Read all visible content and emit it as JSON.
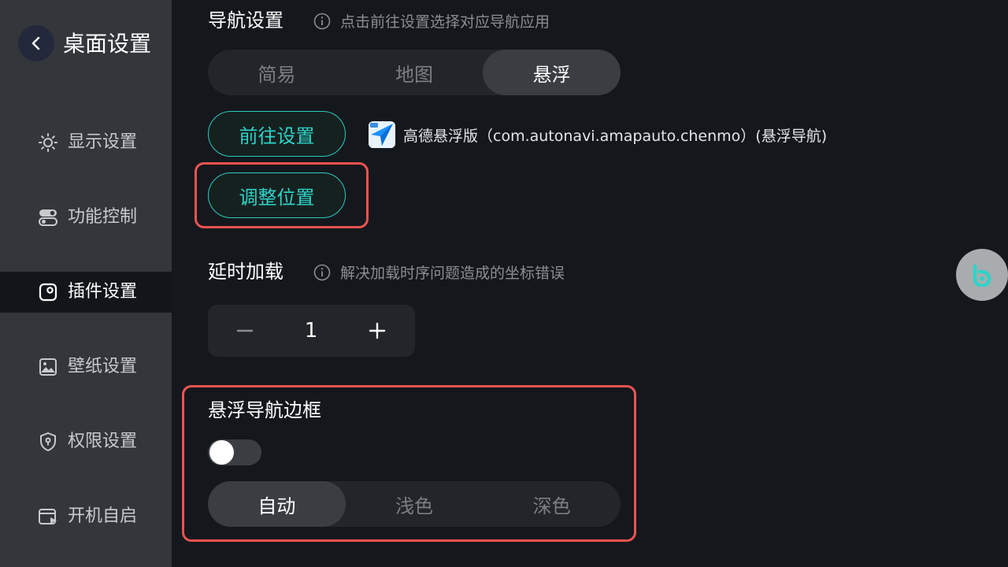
{
  "sidebar": {
    "title": "桌面设置",
    "items": [
      {
        "label": "显示设置",
        "icon": "sun-icon",
        "active": false
      },
      {
        "label": "功能控制",
        "icon": "toggle-icon",
        "active": false
      },
      {
        "label": "插件设置",
        "icon": "plugin-icon",
        "active": true
      },
      {
        "label": "壁纸设置",
        "icon": "image-icon",
        "active": false
      },
      {
        "label": "权限设置",
        "icon": "shield-icon",
        "active": false
      },
      {
        "label": "开机自启",
        "icon": "autostart-icon",
        "active": false
      }
    ]
  },
  "nav_settings": {
    "title": "导航设置",
    "hint": "点击前往设置选择对应导航应用",
    "modes": [
      "简易",
      "地图",
      "悬浮"
    ],
    "selected_mode": "悬浮",
    "goto_button": "前往设置",
    "app_label": "高德悬浮版（com.autonavi.amapauto.chenmo）(悬浮导航)",
    "adjust_button": "调整位置"
  },
  "delay_load": {
    "title": "延时加载",
    "hint": "解决加载时序问题造成的坐标错误",
    "value": "1"
  },
  "float_border": {
    "title": "悬浮导航边框",
    "enabled": false,
    "themes": [
      "自动",
      "浅色",
      "深色"
    ],
    "selected_theme": "自动"
  },
  "colors": {
    "accent": "#2ed3c8",
    "highlight": "#ef5350",
    "sidebar_bg": "#33373c",
    "main_bg": "#14181d"
  }
}
